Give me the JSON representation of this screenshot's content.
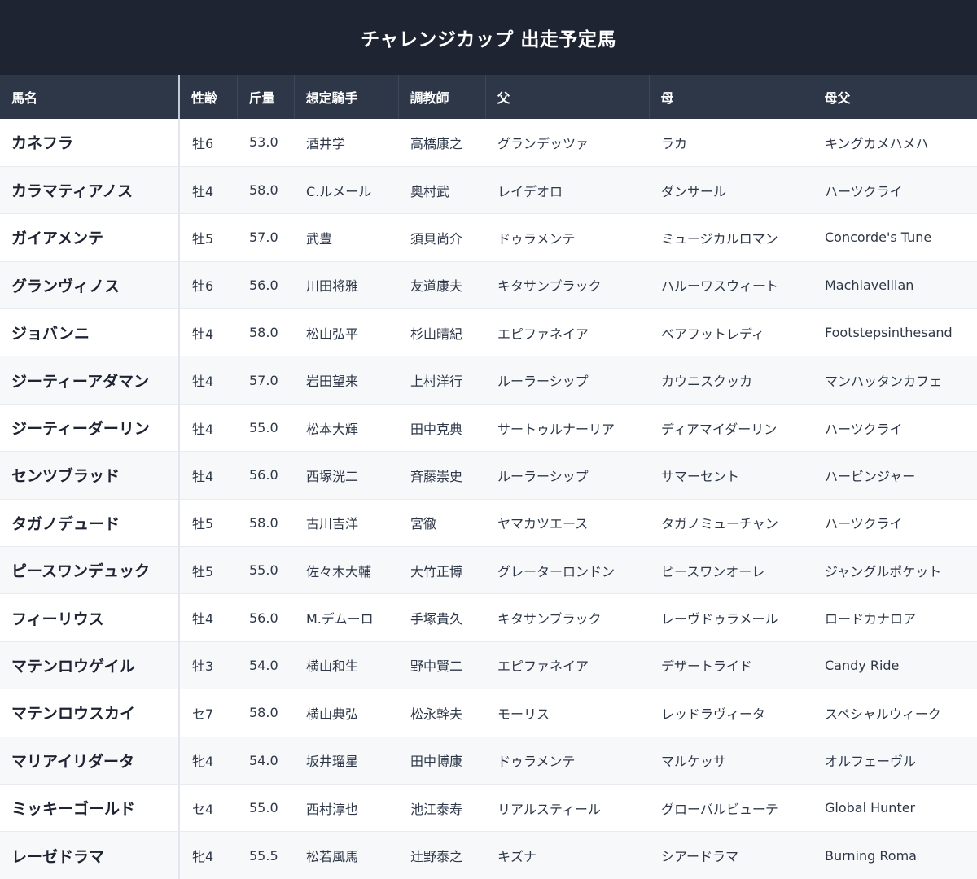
{
  "title": "チャレンジカップ 出走予定馬",
  "columns": [
    "馬名",
    "性齢",
    "斤量",
    "想定騎手",
    "調教師",
    "父",
    "母",
    "母父"
  ],
  "rows": [
    [
      "カネフラ",
      "牡6",
      "53.0",
      "酒井学",
      "高橋康之",
      "グランデッツァ",
      "ラカ",
      "キングカメハメハ"
    ],
    [
      "カラマティアノス",
      "牡4",
      "58.0",
      "C.ルメール",
      "奥村武",
      "レイデオロ",
      "ダンサール",
      "ハーツクライ"
    ],
    [
      "ガイアメンテ",
      "牡5",
      "57.0",
      "武豊",
      "須貝尚介",
      "ドゥラメンテ",
      "ミュージカルロマン",
      "Concorde's Tune"
    ],
    [
      "グランヴィノス",
      "牡6",
      "56.0",
      "川田将雅",
      "友道康夫",
      "キタサンブラック",
      "ハルーワスウィート",
      "Machiavellian"
    ],
    [
      "ジョバンニ",
      "牡4",
      "58.0",
      "松山弘平",
      "杉山晴紀",
      "エピファネイア",
      "ベアフットレディ",
      "Footstepsinthesand"
    ],
    [
      "ジーティーアダマン",
      "牡4",
      "57.0",
      "岩田望来",
      "上村洋行",
      "ルーラーシップ",
      "カウニスクッカ",
      "マンハッタンカフェ"
    ],
    [
      "ジーティーダーリン",
      "牡4",
      "55.0",
      "松本大輝",
      "田中克典",
      "サートゥルナーリア",
      "ディアマイダーリン",
      "ハーツクライ"
    ],
    [
      "センツブラッド",
      "牡4",
      "56.0",
      "西塚洸二",
      "斉藤崇史",
      "ルーラーシップ",
      "サマーセント",
      "ハービンジャー"
    ],
    [
      "タガノデュード",
      "牡5",
      "58.0",
      "古川吉洋",
      "宮徹",
      "ヤマカツエース",
      "タガノミューチャン",
      "ハーツクライ"
    ],
    [
      "ピースワンデュック",
      "牡5",
      "55.0",
      "佐々木大輔",
      "大竹正博",
      "グレーターロンドン",
      "ピースワンオーレ",
      "ジャングルポケット"
    ],
    [
      "フィーリウス",
      "牡4",
      "56.0",
      "M.デムーロ",
      "手塚貴久",
      "キタサンブラック",
      "レーヴドゥラメール",
      "ロードカナロア"
    ],
    [
      "マテンロウゲイル",
      "牡3",
      "54.0",
      "横山和生",
      "野中賢二",
      "エピファネイア",
      "デザートライド",
      "Candy Ride"
    ],
    [
      "マテンロウスカイ",
      "セ7",
      "58.0",
      "横山典弘",
      "松永幹夫",
      "モーリス",
      "レッドラヴィータ",
      "スペシャルウィーク"
    ],
    [
      "マリアイリダータ",
      "牝4",
      "54.0",
      "坂井瑠星",
      "田中博康",
      "ドゥラメンテ",
      "マルケッサ",
      "オルフェーヴル"
    ],
    [
      "ミッキーゴールド",
      "セ4",
      "55.0",
      "西村淳也",
      "池江泰寿",
      "リアルスティール",
      "グローバルビューテ",
      "Global Hunter"
    ],
    [
      "レーゼドラマ",
      "牝4",
      "55.5",
      "松若風馬",
      "辻野泰之",
      "キズナ",
      "シアードラマ",
      "Burning Roma"
    ]
  ]
}
